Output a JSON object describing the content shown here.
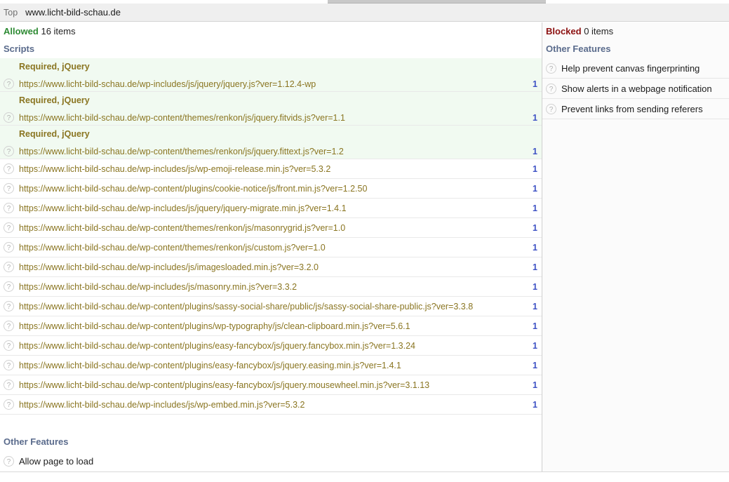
{
  "window": {
    "site_bar": {
      "top_label": "Top",
      "host": "www.licht-bild-schau.de"
    }
  },
  "left": {
    "summary": {
      "status": "Allowed",
      "count_text": "16 items"
    },
    "scripts_title": "Scripts",
    "scripts": [
      {
        "required": "Required, jQuery",
        "url": "https://www.licht-bild-schau.de/wp-includes/js/jquery/jquery.js?ver=1.12.4-wp",
        "count": "1",
        "highlighted": true
      },
      {
        "required": "Required, jQuery",
        "url": "https://www.licht-bild-schau.de/wp-content/themes/renkon/js/jquery.fitvids.js?ver=1.1",
        "count": "1",
        "highlighted": true
      },
      {
        "required": "Required, jQuery",
        "url": "https://www.licht-bild-schau.de/wp-content/themes/renkon/js/jquery.fittext.js?ver=1.2",
        "count": "1",
        "highlighted": true
      },
      {
        "required": "",
        "url": "https://www.licht-bild-schau.de/wp-includes/js/wp-emoji-release.min.js?ver=5.3.2",
        "count": "1",
        "highlighted": false
      },
      {
        "required": "",
        "url": "https://www.licht-bild-schau.de/wp-content/plugins/cookie-notice/js/front.min.js?ver=1.2.50",
        "count": "1",
        "highlighted": false
      },
      {
        "required": "",
        "url": "https://www.licht-bild-schau.de/wp-includes/js/jquery/jquery-migrate.min.js?ver=1.4.1",
        "count": "1",
        "highlighted": false
      },
      {
        "required": "",
        "url": "https://www.licht-bild-schau.de/wp-content/themes/renkon/js/masonrygrid.js?ver=1.0",
        "count": "1",
        "highlighted": false
      },
      {
        "required": "",
        "url": "https://www.licht-bild-schau.de/wp-content/themes/renkon/js/custom.js?ver=1.0",
        "count": "1",
        "highlighted": false
      },
      {
        "required": "",
        "url": "https://www.licht-bild-schau.de/wp-includes/js/imagesloaded.min.js?ver=3.2.0",
        "count": "1",
        "highlighted": false
      },
      {
        "required": "",
        "url": "https://www.licht-bild-schau.de/wp-includes/js/masonry.min.js?ver=3.3.2",
        "count": "1",
        "highlighted": false
      },
      {
        "required": "",
        "url": "https://www.licht-bild-schau.de/wp-content/plugins/sassy-social-share/public/js/sassy-social-share-public.js?ver=3.3.8",
        "count": "1",
        "highlighted": false
      },
      {
        "required": "",
        "url": "https://www.licht-bild-schau.de/wp-content/plugins/wp-typography/js/clean-clipboard.min.js?ver=5.6.1",
        "count": "1",
        "highlighted": false
      },
      {
        "required": "",
        "url": "https://www.licht-bild-schau.de/wp-content/plugins/easy-fancybox/js/jquery.fancybox.min.js?ver=1.3.24",
        "count": "1",
        "highlighted": false
      },
      {
        "required": "",
        "url": "https://www.licht-bild-schau.de/wp-content/plugins/easy-fancybox/js/jquery.easing.min.js?ver=1.4.1",
        "count": "1",
        "highlighted": false
      },
      {
        "required": "",
        "url": "https://www.licht-bild-schau.de/wp-content/plugins/easy-fancybox/js/jquery.mousewheel.min.js?ver=3.1.13",
        "count": "1",
        "highlighted": false
      },
      {
        "required": "",
        "url": "https://www.licht-bild-schau.de/wp-includes/js/wp-embed.min.js?ver=5.3.2",
        "count": "1",
        "highlighted": false
      }
    ],
    "other_features_title": "Other Features",
    "other_features": [
      {
        "label": "Allow page to load"
      }
    ]
  },
  "right": {
    "summary": {
      "status": "Blocked",
      "count_text": "0 items"
    },
    "other_features_title": "Other Features",
    "other_features": [
      {
        "label": "Help prevent canvas fingerprinting"
      },
      {
        "label": "Show alerts in a webpage notification"
      },
      {
        "label": "Prevent links from sending referers"
      }
    ]
  },
  "icons": {
    "help": "?"
  },
  "colors": {
    "allowed": "#2e8b34",
    "blocked": "#8c1010",
    "group_title": "#5a6b8c",
    "url": "#8a7521",
    "count": "#3d51c4",
    "allowed_row_bg": "#f1faf1"
  }
}
